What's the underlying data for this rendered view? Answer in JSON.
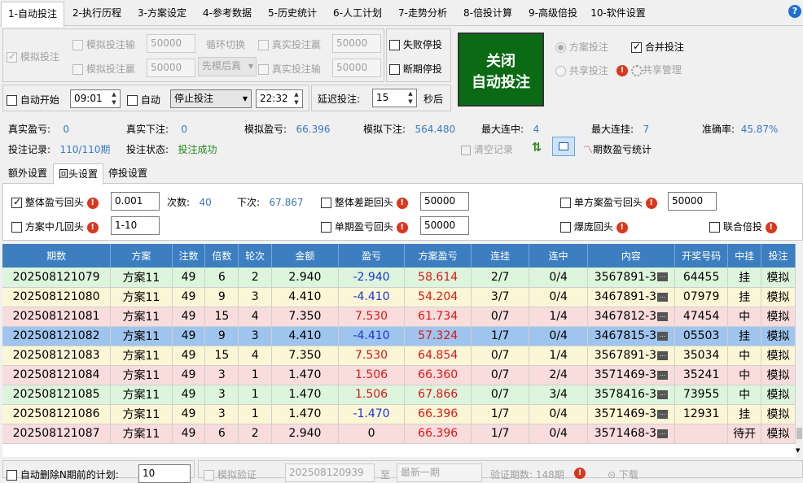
{
  "tabs": [
    {
      "label": "1-自动投注",
      "active": true
    },
    {
      "label": "2-执行历程"
    },
    {
      "label": "3-方案设定"
    },
    {
      "label": "4-参考数据"
    },
    {
      "label": "5-历史统计"
    },
    {
      "label": "6-人工计划"
    },
    {
      "label": "7-走势分析"
    },
    {
      "label": "8-倍投计算"
    },
    {
      "label": "9-高级倍投"
    },
    {
      "label": "10-软件设置"
    }
  ],
  "help_icon": "?",
  "sim": {
    "sim_bet": "模拟投注",
    "sim_loss": "模拟投注输",
    "sim_win": "模拟投注赢",
    "sim_loss_val": "50000",
    "sim_win_val": "50000",
    "cycle_switch": "循环切换",
    "order_select": "先模后真",
    "real_win": "真实投注赢",
    "real_loss": "真实投注输",
    "real_win_val": "50000",
    "real_loss_val": "50000",
    "fail_stop": "失败停投",
    "break_stop": "断期停投"
  },
  "close_button": {
    "line1": "关闭",
    "line2": "自动投注"
  },
  "right": {
    "plan_bet": "方案投注",
    "merge_bet": "合并投注",
    "share_bet": "共享投注",
    "share_manage": "共享管理"
  },
  "auto": {
    "auto_start": "自动开始",
    "start_time": "09:01",
    "auto": "自动",
    "stop_select": "停止投注",
    "stop_time": "22:32",
    "delay_label": "延迟投注:",
    "delay_val": "15",
    "sec": "秒后"
  },
  "stats": {
    "real_pl_label": "真实盈亏:",
    "real_pl": "0",
    "real_bet_label": "真实下注:",
    "real_bet": "0",
    "sim_pl_label": "模拟盈亏:",
    "sim_pl": "66.396",
    "sim_bet_label": "模拟下注:",
    "sim_bet": "564.480",
    "max_hit_label": "最大连中:",
    "max_hit": "4",
    "max_miss_label": "最大连挂:",
    "max_miss": "7",
    "acc_label": "准确率:",
    "acc": "45.87%",
    "record_label": "投注记录:",
    "record": "110/110期",
    "state_label": "投注状态:",
    "state": "投注成功",
    "clear": "清空记录",
    "period_stats": "期数盈亏统计"
  },
  "subtabs": [
    "额外设置",
    "回头设置",
    "停投设置"
  ],
  "settings": {
    "overall_pl": "整体盈亏回头",
    "overall_pl_val": "0.001",
    "count_label": "次数:",
    "count": "40",
    "next_label": "下次:",
    "next": "67.867",
    "overall_diff": "整体差距回头",
    "overall_diff_val": "50000",
    "single_plan": "单方案盈亏回头",
    "single_plan_val": "50000",
    "plan_hit": "方案中几回头",
    "plan_hit_val": "1-10",
    "single_period": "单期盈亏回头",
    "single_period_val": "50000",
    "crash": "爆庞回头",
    "joint": "联合倍投"
  },
  "table": {
    "headers": [
      "期数",
      "方案",
      "注数",
      "倍数",
      "轮次",
      "金额",
      "盈亏",
      "方案盈亏",
      "连挂",
      "连中",
      "内容",
      "开奖号码",
      "中挂",
      "投注"
    ],
    "rows": [
      {
        "cls": "c-green",
        "cells": [
          "202508121079",
          "方案11",
          "49",
          "6",
          "2",
          "2.940",
          "-2.940",
          "58.614",
          "2/7",
          "0/4",
          "3567891-3",
          "64455",
          "挂",
          "模拟"
        ]
      },
      {
        "cls": "c-yellow",
        "cells": [
          "202508121080",
          "方案11",
          "49",
          "9",
          "3",
          "4.410",
          "-4.410",
          "54.204",
          "3/7",
          "0/4",
          "3467891-3",
          "07979",
          "挂",
          "模拟"
        ]
      },
      {
        "cls": "c-red",
        "cells": [
          "202508121081",
          "方案11",
          "49",
          "15",
          "4",
          "7.350",
          "7.530",
          "61.734",
          "0/7",
          "1/4",
          "3467812-3",
          "47454",
          "中",
          "模拟"
        ]
      },
      {
        "cls": "c-sel",
        "cells": [
          "202508121082",
          "方案11",
          "49",
          "9",
          "3",
          "4.410",
          "-4.410",
          "57.324",
          "1/7",
          "0/4",
          "3467815-3",
          "05503",
          "挂",
          "模拟"
        ]
      },
      {
        "cls": "c-yellow",
        "cells": [
          "202508121083",
          "方案11",
          "49",
          "15",
          "4",
          "7.350",
          "7.530",
          "64.854",
          "0/7",
          "1/4",
          "3567891-3",
          "35034",
          "中",
          "模拟"
        ]
      },
      {
        "cls": "c-red",
        "cells": [
          "202508121084",
          "方案11",
          "49",
          "3",
          "1",
          "1.470",
          "1.506",
          "66.360",
          "0/7",
          "2/4",
          "3571469-3",
          "35241",
          "中",
          "模拟"
        ]
      },
      {
        "cls": "c-green",
        "cells": [
          "202508121085",
          "方案11",
          "49",
          "3",
          "1",
          "1.470",
          "1.506",
          "67.866",
          "0/7",
          "3/4",
          "3578416-3",
          "73955",
          "中",
          "模拟"
        ]
      },
      {
        "cls": "c-yellow",
        "cells": [
          "202508121086",
          "方案11",
          "49",
          "3",
          "1",
          "1.470",
          "-1.470",
          "66.396",
          "1/7",
          "0/4",
          "3571469-3",
          "12931",
          "挂",
          "模拟"
        ]
      },
      {
        "cls": "c-red",
        "cells": [
          "202508121087",
          "方案11",
          "49",
          "6",
          "2",
          "2.940",
          "0",
          "66.396",
          "1/7",
          "0/4",
          "3571468-3",
          "",
          "待开",
          "模拟"
        ]
      }
    ]
  },
  "bottom": {
    "auto_delete": "自动删除N期前的计划:",
    "auto_delete_val": "10",
    "sim_verify": "模拟验证",
    "from_val": "202508120939",
    "to": "至",
    "latest": "最新一期",
    "verify_count": "验证期数: 148期",
    "download": "下载"
  }
}
